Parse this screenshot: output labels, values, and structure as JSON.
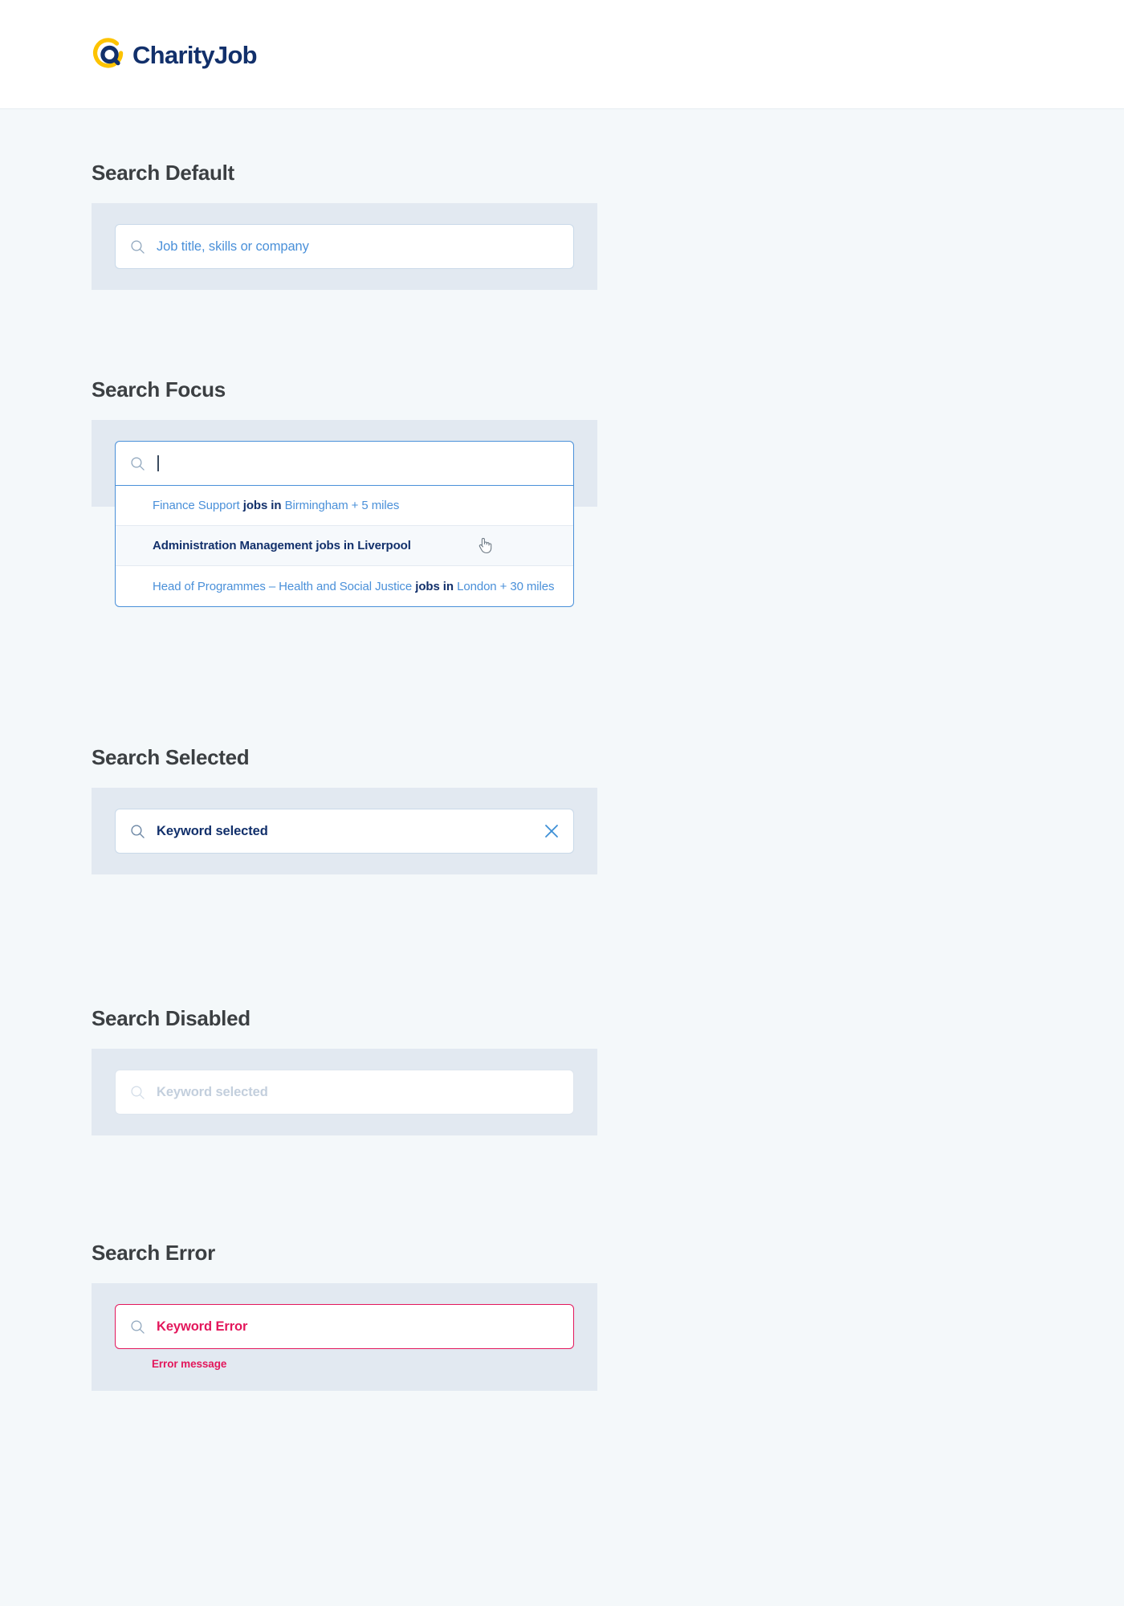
{
  "brand": {
    "name": "CharityJob",
    "logo_icon": "charityjob-logo-icon",
    "yellow": "#FDC300",
    "navy": "#12306B"
  },
  "colors": {
    "page_background": "#F4F8FA",
    "panel_background": "#E2E9F1",
    "field_border": "#C9D9E9",
    "focus_border": "#4A90D9",
    "accent_blue": "#4A90D9",
    "text_navy": "#12306B",
    "heading": "#3B3F42",
    "disabled": "#C3CFDD",
    "error": "#E3175C"
  },
  "sections": {
    "default": {
      "title": "Search Default",
      "field": {
        "icon": "search-icon",
        "placeholder": "Job title, skills or company",
        "value": ""
      }
    },
    "focus": {
      "title": "Search Focus",
      "field": {
        "icon": "search-icon",
        "placeholder": "",
        "value": ""
      },
      "suggestions": [
        {
          "keyword": "Finance Support",
          "connector": "jobs in",
          "location": "Birmingham + 5 miles",
          "hovered": false
        },
        {
          "keyword": "Administration Management",
          "connector": "jobs in",
          "location": "Liverpool",
          "hovered": true
        },
        {
          "keyword": "Head of Programmes – Health and Social Justice",
          "connector": "jobs in",
          "location": "London + 30 miles",
          "hovered": false
        }
      ],
      "cursor": "pointer-hand-cursor"
    },
    "selected": {
      "title": "Search Selected",
      "field": {
        "icon": "search-icon",
        "value": "Keyword selected",
        "clear_icon": "close-icon"
      }
    },
    "disabled": {
      "title": "Search Disabled",
      "field": {
        "icon": "search-icon",
        "value": "Keyword selected"
      }
    },
    "error": {
      "title": "Search Error",
      "field": {
        "icon": "search-icon",
        "value": "Keyword Error"
      },
      "message": "Error message"
    }
  }
}
